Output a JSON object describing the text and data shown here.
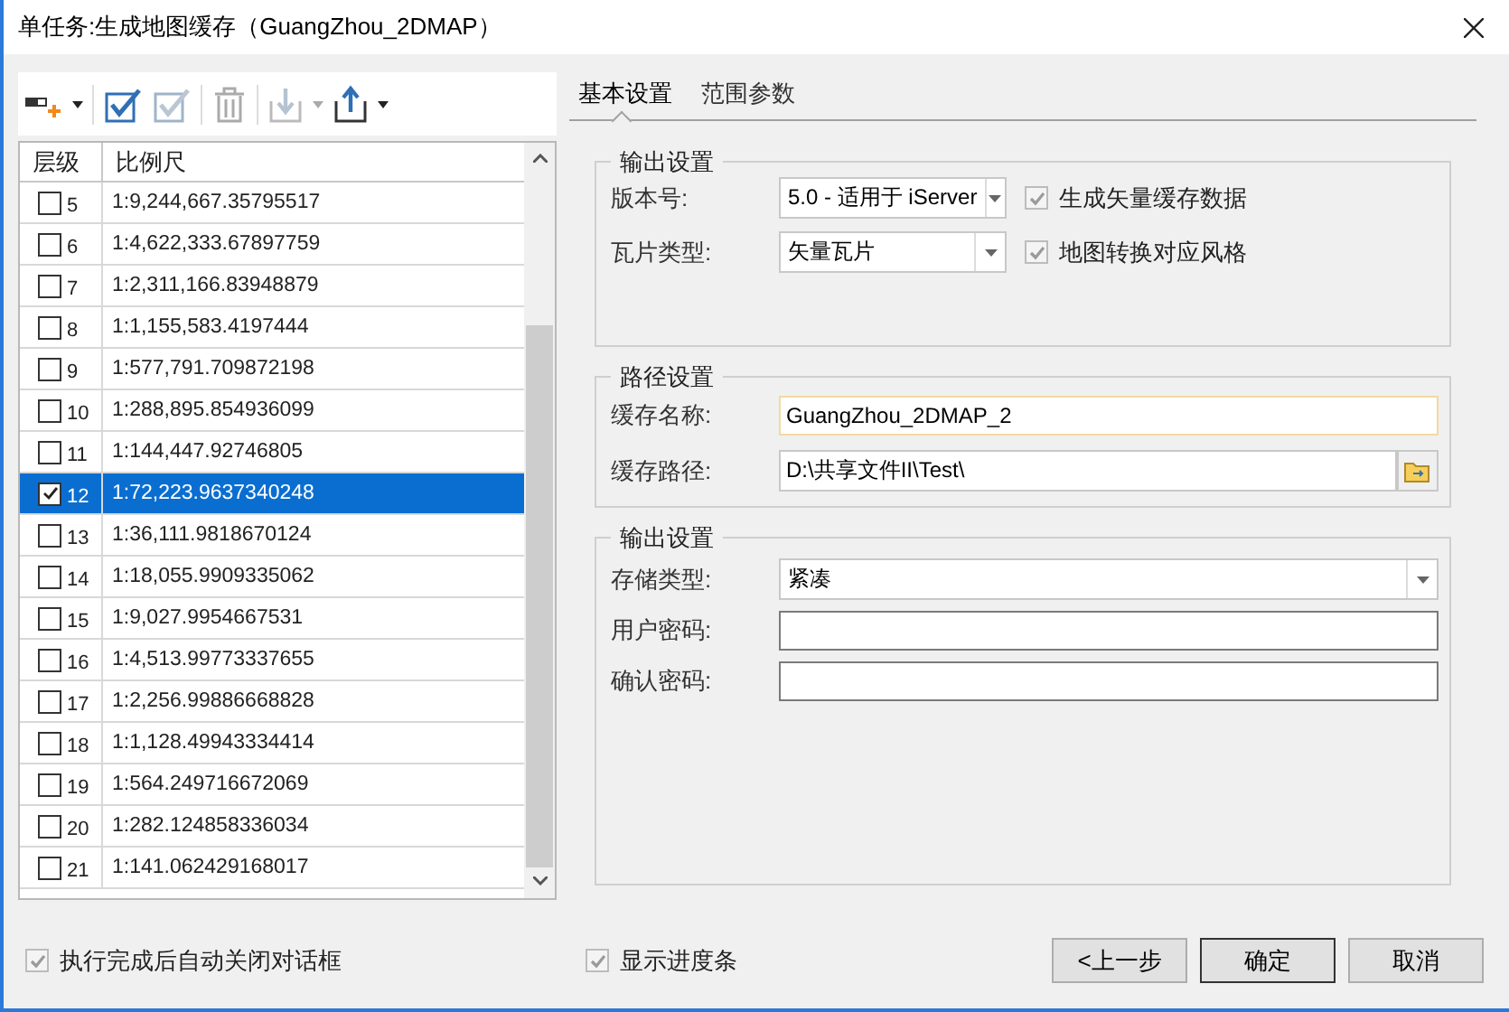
{
  "window": {
    "title": "单任务:生成地图缓存（GuangZhou_2DMAP）"
  },
  "table": {
    "columns": [
      "层级",
      "比例尺"
    ],
    "rows": [
      {
        "level": "5",
        "scale": "1:9,244,667.35795517",
        "checked": false,
        "selected": false
      },
      {
        "level": "6",
        "scale": "1:4,622,333.67897759",
        "checked": false,
        "selected": false
      },
      {
        "level": "7",
        "scale": "1:2,311,166.83948879",
        "checked": false,
        "selected": false
      },
      {
        "level": "8",
        "scale": "1:1,155,583.4197444",
        "checked": false,
        "selected": false
      },
      {
        "level": "9",
        "scale": "1:577,791.709872198",
        "checked": false,
        "selected": false
      },
      {
        "level": "10",
        "scale": "1:288,895.854936099",
        "checked": false,
        "selected": false
      },
      {
        "level": "11",
        "scale": "1:144,447.92746805",
        "checked": false,
        "selected": false
      },
      {
        "level": "12",
        "scale": "1:72,223.9637340248",
        "checked": true,
        "selected": true
      },
      {
        "level": "13",
        "scale": "1:36,111.9818670124",
        "checked": false,
        "selected": false
      },
      {
        "level": "14",
        "scale": "1:18,055.9909335062",
        "checked": false,
        "selected": false
      },
      {
        "level": "15",
        "scale": "1:9,027.9954667531",
        "checked": false,
        "selected": false
      },
      {
        "level": "16",
        "scale": "1:4,513.99773337655",
        "checked": false,
        "selected": false
      },
      {
        "level": "17",
        "scale": "1:2,256.99886668828",
        "checked": false,
        "selected": false
      },
      {
        "level": "18",
        "scale": "1:1,128.49943334414",
        "checked": false,
        "selected": false
      },
      {
        "level": "19",
        "scale": "1:564.249716672069",
        "checked": false,
        "selected": false
      },
      {
        "level": "20",
        "scale": "1:282.124858336034",
        "checked": false,
        "selected": false
      },
      {
        "level": "21",
        "scale": "1:141.062429168017",
        "checked": false,
        "selected": false
      }
    ]
  },
  "tabs": [
    {
      "label": "基本设置",
      "selected": true
    },
    {
      "label": "范围参数",
      "selected": false
    }
  ],
  "output_group": {
    "title": "输出设置",
    "rows": [
      {
        "label": "版本号:",
        "value": "5.0  - 适用于 iServer",
        "checkbox": {
          "label": "生成矢量缓存数据",
          "checked": true,
          "disabled": true
        }
      },
      {
        "label": "瓦片类型:",
        "value": "矢量瓦片",
        "checkbox": {
          "label": "地图转换对应风格",
          "checked": true,
          "disabled": true
        }
      }
    ]
  },
  "path_group": {
    "title": "路径设置",
    "name_label": "缓存名称:",
    "name_value": "GuangZhou_2DMAP_2",
    "path_label": "缓存路径:",
    "path_value": "D:\\共享文件II\\Test\\"
  },
  "storage_group": {
    "title": "输出设置",
    "type_label": "存储类型:",
    "type_value": "紧凑",
    "password_label": "用户密码:",
    "confirm_label": "确认密码:"
  },
  "footer": {
    "checkboxes": [
      {
        "label": "执行完成后自动关闭对话框",
        "checked": true,
        "disabled": true
      },
      {
        "label": "显示进度条",
        "checked": true,
        "disabled": true
      }
    ],
    "buttons": [
      {
        "label": "<上一步",
        "default": false
      },
      {
        "label": "确定",
        "default": true
      },
      {
        "label": "取消",
        "default": false
      }
    ]
  }
}
